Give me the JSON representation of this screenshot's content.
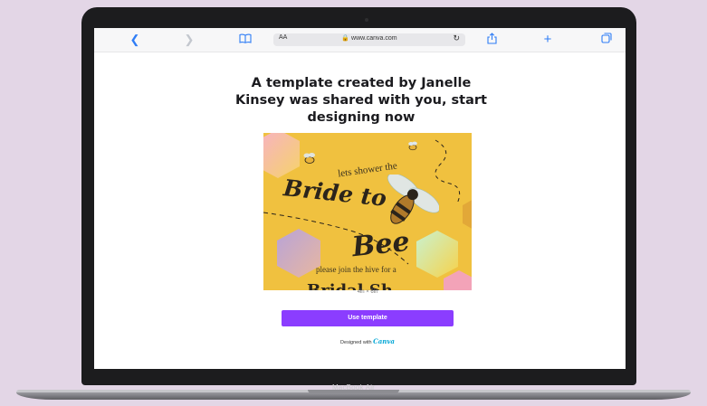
{
  "colors": {
    "background": "#e3d6e6",
    "accent": "#8b3dff",
    "safari_blue": "#2f7df6",
    "card": "#f0c13f"
  },
  "browser": {
    "back_icon": "chevron-left-icon",
    "forward_icon": "chevron-right-icon",
    "bookmarks_icon": "book-icon",
    "text_size": "AA",
    "url": "www.canva.com",
    "reload_icon": "reload-icon",
    "share_icon": "share-icon",
    "new_tab_icon": "plus-icon",
    "tabs_icon": "tabs-icon"
  },
  "page": {
    "headline": "A template created by Janelle Kinsey was shared with you, start designing now",
    "preview": {
      "line1": "lets shower the",
      "line2": "Bride to",
      "line3": "Bee",
      "line4": "please join the hive for a",
      "line5": "Bridal Sh"
    },
    "size_label": "4in × 6in",
    "use_template": "Use template",
    "designed_with": "Designed with",
    "brand": "Canva"
  },
  "device": {
    "label": "MacBook Air"
  }
}
